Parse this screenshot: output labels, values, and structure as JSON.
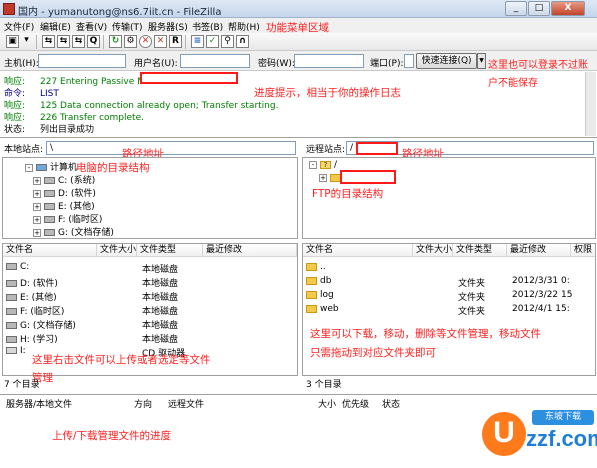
{
  "window": {
    "title": "国内 - yumanutong@ns6.7iit.cn - FileZilla",
    "minimize": "_",
    "maximize": "□",
    "close": "X"
  },
  "menu": [
    "文件(F)",
    "编辑(E)",
    "查看(V)",
    "传输(T)",
    "服务器(S)",
    "书签(B)",
    "帮助(H)"
  ],
  "toolbar_glyphs": [
    "▣",
    "▾",
    "⇆",
    "⇆",
    "⇆",
    "Q",
    "↻",
    "⚙",
    "✕",
    "✕",
    "R",
    "≡",
    "✓",
    "⚲",
    "∩"
  ],
  "connect": {
    "host_label": "主机(H):",
    "user_label": "用户名(U):",
    "pass_label": "密码(W):",
    "port_label": "端口(P):",
    "quickconnect": "快速连接(Q)",
    "dropdown": "▼"
  },
  "log": [
    {
      "label": "响应:",
      "text": "227 Entering Passive Mode",
      "kind": "resp"
    },
    {
      "label": "命令:",
      "text": "LIST",
      "kind": "cmd"
    },
    {
      "label": "响应:",
      "text": "125 Data connection already open; Transfer starting.",
      "kind": "resp"
    },
    {
      "label": "响应:",
      "text": "226 Transfer complete.",
      "kind": "resp"
    },
    {
      "label": "状态:",
      "text": "列出目录成功",
      "kind": "stat"
    }
  ],
  "local": {
    "site_label": "本地站点:",
    "path": "\\",
    "tree": [
      {
        "label": "计算机",
        "icon": "computer-icon",
        "expander": "-"
      },
      {
        "label": "C: (系统)",
        "icon": "drive-icon",
        "expander": "+"
      },
      {
        "label": "D: (软件)",
        "icon": "drive-icon",
        "expander": "+"
      },
      {
        "label": "E: (其他)",
        "icon": "drive-icon",
        "expander": "+"
      },
      {
        "label": "F: (临时区)",
        "icon": "drive-icon",
        "expander": "+"
      },
      {
        "label": "G: (文档存储)",
        "icon": "drive-icon",
        "expander": "+"
      }
    ],
    "columns": [
      "文件名",
      "文件大小",
      "文件类型",
      "最近修改"
    ],
    "rows": [
      {
        "name": "C:",
        "size": "",
        "type": "本地磁盘"
      },
      {
        "name": "D: (软件)",
        "size": "",
        "type": "本地磁盘"
      },
      {
        "name": "E: (其他)",
        "size": "",
        "type": "本地磁盘"
      },
      {
        "name": "F: (临时区)",
        "size": "",
        "type": "本地磁盘"
      },
      {
        "name": "G: (文档存储)",
        "size": "",
        "type": "本地磁盘"
      },
      {
        "name": "H: (学习)",
        "size": "",
        "type": "本地磁盘"
      },
      {
        "name": "I:",
        "size": "",
        "type": "CD 驱动器"
      }
    ],
    "status": "7 个目录"
  },
  "remote": {
    "site_label": "远程站点:",
    "path": "/",
    "tree": [
      {
        "label": "/",
        "icon": "question-folder-icon",
        "expander": "-"
      },
      {
        "label": "",
        "icon": "folder-icon",
        "expander": "+"
      }
    ],
    "columns": [
      "文件名",
      "文件大小",
      "文件类型",
      "最近修改",
      "权限"
    ],
    "rows": [
      {
        "name": "..",
        "type": "",
        "date": ""
      },
      {
        "name": "db",
        "type": "文件夹",
        "date": "2012/3/31 0:"
      },
      {
        "name": "log",
        "type": "文件夹",
        "date": "2012/3/22 15"
      },
      {
        "name": "web",
        "type": "文件夹",
        "date": "2012/4/1 15:"
      }
    ],
    "status": "3 个目录"
  },
  "queue": {
    "columns": [
      "服务器/本地文件",
      "方向",
      "远程文件",
      "大小",
      "优先级",
      "状态"
    ]
  },
  "annotations": {
    "menu_area": "功能菜单区域",
    "login_1": "这里也可以登录不过账",
    "login_2": "户不能保存",
    "log_hint": "进度提示，相当于你的操作日志",
    "local_path": "路径地址",
    "local_tree": "电脑的目录结构",
    "remote_path": "路径地址",
    "remote_tree": "FTP的目录结构",
    "local_list_1": "这里右击文件可以上传或者选定等文件",
    "local_list_2": "管理",
    "remote_list_1": "这里可以下载，移动，删除等文件管理，移动文件",
    "remote_list_2": "只需拖动到对应文件夹即可",
    "queue_hint": "上传/下载管理文件的进度"
  },
  "logo": {
    "mark": "U",
    "word": "zzf.com",
    "badge": "东坡下载"
  },
  "colors": {
    "annotation": "#ff2020",
    "response_text": "#008000",
    "command_text": "#000080",
    "logo_orange": "#ff7a1a",
    "logo_blue": "#1f7fd6"
  }
}
